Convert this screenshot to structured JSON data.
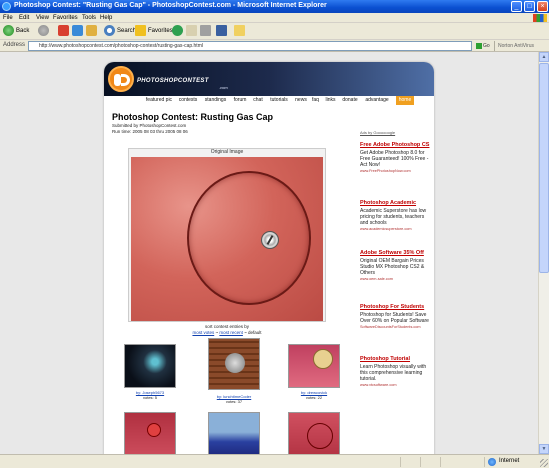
{
  "window": {
    "title": "Photoshop Contest: \"Rusting Gas Cap\" - PhotoshopContest.com - Microsoft Internet Explorer",
    "minimize": "_",
    "maximize": "□",
    "close": "×"
  },
  "menubar": [
    "File",
    "Edit",
    "View",
    "Favorites",
    "Tools",
    "Help"
  ],
  "toolbar": {
    "back": "Back",
    "search": "Search",
    "favorites": "Favorites"
  },
  "address": {
    "label": "Address",
    "url": "http://www.photoshopcontest.com/photoshop-contest/rusting-gas-cap.html",
    "go": "Go",
    "links": "Norton AntiVirus"
  },
  "site": {
    "logo_text": "PHOTOSHOPCONTEST",
    "logo_sub": ".com",
    "nav": [
      "featured pic",
      "contests",
      "standings",
      "forum",
      "chat",
      "tutorials",
      "news",
      "faq",
      "links",
      "donate",
      "advantage",
      "home"
    ],
    "nav_active": "home"
  },
  "contest": {
    "title": "Photoshop Contest: Rusting Gas Cap",
    "submitted_by": "Submitted by PhotoshopContest.com",
    "run_time": "Run time: 2005 08 03 thru 2005 08 06",
    "original_label": "Original Image",
    "sort_label": "sort contest entries by",
    "sort_options": [
      "most votes",
      "most recent",
      "default"
    ]
  },
  "entries": [
    {
      "by": "by: Joseph5673",
      "votes": "votes: 5"
    },
    {
      "by": "by: lunchtimeCoder",
      "votes": "votes: 37"
    },
    {
      "by": "by: drewcovick",
      "votes": "votes: 22"
    }
  ],
  "ads": {
    "header": "Ads by Goooooogle",
    "items": [
      {
        "title": "Free Adobe Photoshop CS",
        "body": "Get Adobe Photoshop 8.0 for Free Guaranteed! 100% Free - Act Now!",
        "url": "www.FreePhotoshopNow.com"
      },
      {
        "title": "Photoshop Academic",
        "body": "Academic Superstore has low pricing for students, teachers and schools",
        "url": "www.academicsuperstore.com"
      },
      {
        "title": "Adobe Software 35% Off",
        "body": "Original OEM Bargain Prices Studio MX Photoshop CS2 & Others",
        "url": "www.oem-sale.com"
      },
      {
        "title": "Photoshop For Students",
        "body": "Photoshop for Students! Save Over 60% on Popular Software",
        "url": "SoftwareDiscountsForStudents.com"
      },
      {
        "title": "Photoshop Tutorial",
        "body": "Learn Photoshop visually with this comprehensive learning tutorial.",
        "url": "www.vtcsoftware.com"
      }
    ]
  },
  "status": {
    "zone": "Internet"
  }
}
